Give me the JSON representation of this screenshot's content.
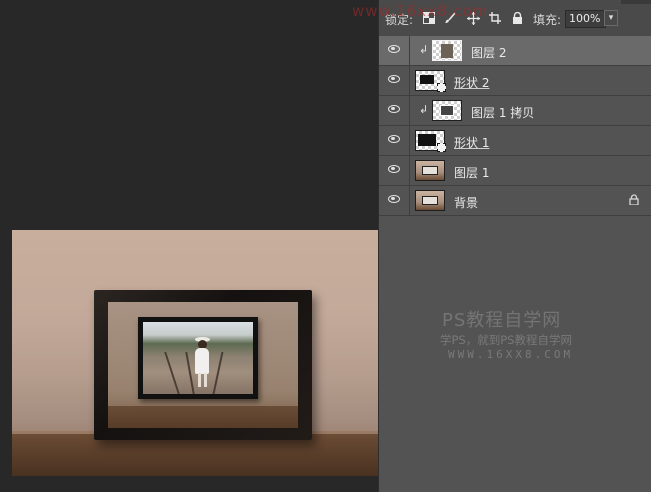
{
  "lock_bar": {
    "lock_label": "锁定:",
    "icons": [
      "transparency-lock-icon",
      "brush-icon",
      "move-icon",
      "crop-icon",
      "lock-icon"
    ],
    "fill_label": "填充:",
    "fill_value": "100%",
    "dropdown_glyph": "▾"
  },
  "layers": [
    {
      "name": "图层 2",
      "selected": true,
      "clipped": true,
      "thumb": "transparent-photo"
    },
    {
      "name": "形状 2",
      "selected": false,
      "clipped": false,
      "thumb": "shape"
    },
    {
      "name": "图层 1 拷贝",
      "selected": false,
      "clipped": true,
      "thumb": "transparent-frame"
    },
    {
      "name": "形状 1",
      "selected": false,
      "clipped": false,
      "thumb": "shape"
    },
    {
      "name": "图层 1",
      "selected": false,
      "clipped": false,
      "thumb": "photo"
    },
    {
      "name": "背景",
      "selected": false,
      "clipped": false,
      "thumb": "photo",
      "locked": true
    }
  ],
  "glyphs": {
    "clip_arrow": "↲",
    "lock": "🔒"
  },
  "watermark": {
    "title": "PS教程自学网",
    "line1": "学PS，就到PS教程自学网",
    "line2": "WWW.16XX8.COM",
    "top": "www.16xx8.com"
  },
  "colors": {
    "panel_bg": "#535353",
    "selected_row": "#6a6a6a",
    "workspace_bg": "#282828"
  }
}
